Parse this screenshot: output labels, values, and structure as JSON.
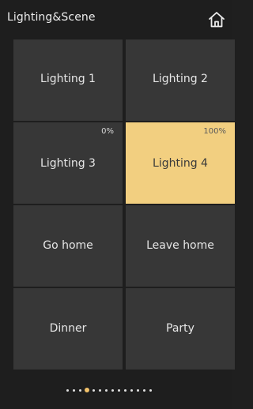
{
  "header": {
    "title": "Lighting&Scene",
    "home_icon": "home-icon"
  },
  "tiles": [
    {
      "label": "Lighting 1",
      "percent": "",
      "active": false
    },
    {
      "label": "Lighting 2",
      "percent": "",
      "active": false
    },
    {
      "label": "Lighting 3",
      "percent": "0%",
      "active": false
    },
    {
      "label": "Lighting 4",
      "percent": "100%",
      "active": true
    },
    {
      "label": "Go home",
      "percent": "",
      "active": false
    },
    {
      "label": "Leave home",
      "percent": "",
      "active": false
    },
    {
      "label": "Dinner",
      "percent": "",
      "active": false
    },
    {
      "label": "Party",
      "percent": "",
      "active": false
    }
  ],
  "pager": {
    "page_count": 14,
    "current_page": 4
  },
  "colors": {
    "background": "#1e1e1e",
    "tile": "#373737",
    "tile_active": "#f2cf80",
    "pager_active": "#f2c26a"
  }
}
